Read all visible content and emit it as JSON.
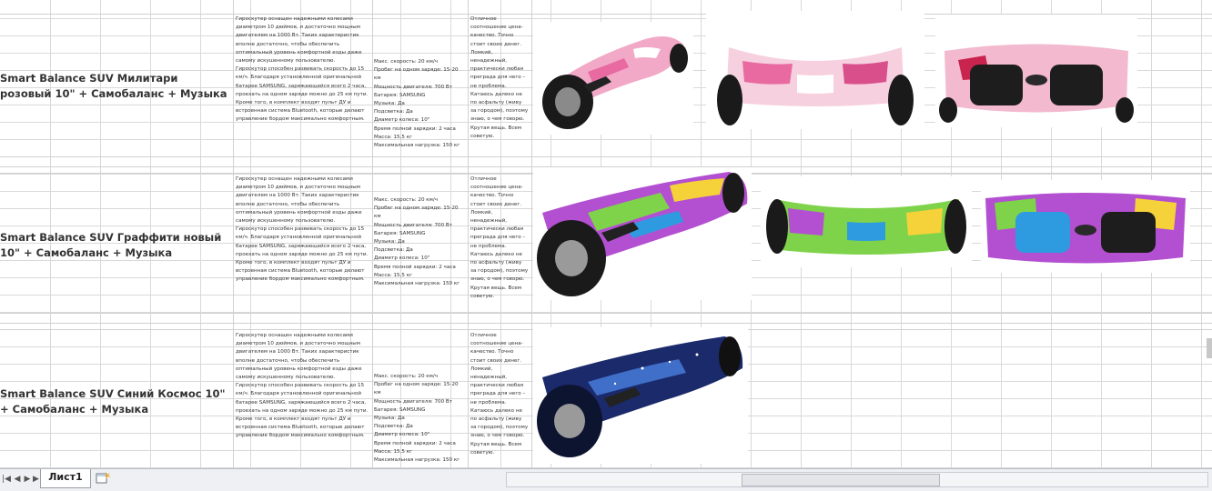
{
  "sheet": {
    "tab_label": "Лист1",
    "products": [
      {
        "name": "Smart Balance SUV Милитари розовый 10\" + Самобаланс + Музыка",
        "description": "Гироскутер оснащен надежными колесами диаметром 10 дюймов, и достаточно мощным двигателем на 1000 Вт. Таких характеристик вполне достаточно, чтобы обеспечить оптимальный уровень комфортной езды даже самому искушенному пользователю.\nГироскутор способен развивать скорость до 15 км/ч. Благодаря установленной оригинальной батарее SAMSUNG, заряжающейся всего 2 часа, проехать на одном заряде можно до 25 км пути. Кроме того, в комплект входят пульт ДУ и встроенная система Bluetooth, которые делают управление бордом максимально комфортным.",
        "specs": "Макс. скорость: 20 км/ч\nПробег на одном заряде: 15-20 км\nМощность двигателя: 700 Вт\nБатарея: SAMSUNG\nМузыка: Да\nПодсветка: Да\nДиаметр колеса: 10\"\nВремя полной зарядки: 2 часа\nМасса: 15,5 кг\nМаксимальная нагрузка: 150 кг",
        "note": "Отличное соотношение цена-качество. Точно стоит своих денег. Ломкий, ненадежный, практически любая преграда для него – не проблема. Катаюсь далеко не по асфальту (живу за городом), поэтому знаю, о чем говорю. Крутая вещь. Всем советую.",
        "colors": [
          "#f2a9c7",
          "#e86aa0",
          "#ffffff"
        ]
      },
      {
        "name": "Smart Balance SUV Граффити новый 10\" + Самобаланс + Музыка",
        "description": "Гироскутер оснащен надежными колесами диаметром 10 дюймов, и достаточно мощным двигателем на 1000 Вт. Таких характеристик вполне достаточно, чтобы обеспечить оптимальный уровень комфортной езды даже самому искушенному пользователю.\nГироскутор способен развивать скорость до 15 км/ч. Благодаря установленной оригинальной батарее SAMSUNG, заряжающейся всего 2 часа, проехать на одном заряде можно до 25 км пути. Кроме того, в комплект входят пульт ДУ и встроенная система Bluetooth, которые делают управление бордом максимально комфортным.",
        "specs": "Макс. скорость: 20 км/ч\nПробег на одном заряде: 15-20 км\nМощность двигателя: 700 Вт\nБатарея: SAMSUNG\nМузыка: Да\nПодсветка: Да\nДиаметр колеса: 10\"\nВремя полной зарядки: 2 часа\nМасса: 15,5 кг\nМаксимальная нагрузка: 150 кг",
        "note": "Отличное соотношение цена-качество. Точно стоит своих денег. Ломкий, ненадежный, практически любая преграда для него – не проблема. Катаюсь далеко не по асфальту (живу за городом), поэтому знаю, о чем говорю. Крутая вещь. Всем советую.",
        "colors": [
          "#7fd34a",
          "#b34fd1",
          "#f5d23a",
          "#2e9be0"
        ]
      },
      {
        "name": "Smart Balance SUV Синий Космос 10\" + Самобаланс + Музыка",
        "description": "Гироскутер оснащен надежными колесами диаметром 10 дюймов, и достаточно мощным двигателем на 1000 Вт. Таких характеристик вполне достаточно, чтобы обеспечить оптимальный уровень комфортной езды даже самому искушенному пользователю.\nГироскутор способен развивать скорость до 15 км/ч. Благодаря установленной оригинальной батарее SAMSUNG, заряжающейся всего 2 часа, проехать на одном заряде можно до 25 км пути. Кроме того, в комплект входят пульт ДУ и встроенная система Bluetooth, которые делают управление бордом максимально комфортным.",
        "specs": "Макс. скорость: 20 км/ч\nПробег на одном заряде: 15-20 км\nМощность двигателя: 700 Вт\nБатарея: SAMSUNG\nМузыка: Да\nПодсветка: Да\nДиаметр колеса: 10\"\nВремя полной зарядки: 2 часа\nМасса: 15,5 кг\nМаксимальная нагрузка: 150 кг",
        "note": "Отличное соотношение цена-качество. Точно стоит своих денег. Ломкий, ненадежный, практически любая преграда для него – не проблема. Катаюсь далеко не по асфальту (живу за городом), поэтому знаю, о чем говорю. Крутая вещь. Всем советую.",
        "colors": [
          "#1b2a6b",
          "#3f6fc8",
          "#0d1430"
        ]
      }
    ]
  },
  "ui": {
    "icons": {
      "first": "first-sheet-icon",
      "prev": "prev-sheet-icon",
      "next": "next-sheet-icon",
      "last": "last-sheet-icon",
      "add": "insert-sheet-icon"
    }
  }
}
